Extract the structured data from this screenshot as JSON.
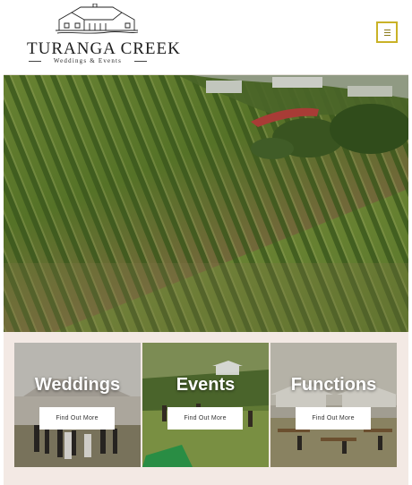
{
  "brand": {
    "title": "Turanga Creek",
    "subtitle": "Weddings & Events"
  },
  "header": {
    "menu_icon": "hamburger-menu-icon",
    "accent_color": "#c9b227"
  },
  "cards": [
    {
      "title": "Weddings",
      "button": "Find Out More"
    },
    {
      "title": "Events",
      "button": "Find Out More"
    },
    {
      "title": "Functions",
      "button": "Find Out More"
    }
  ],
  "colors": {
    "section_background": "#f3e9e4",
    "button_background": "#ffffff"
  }
}
